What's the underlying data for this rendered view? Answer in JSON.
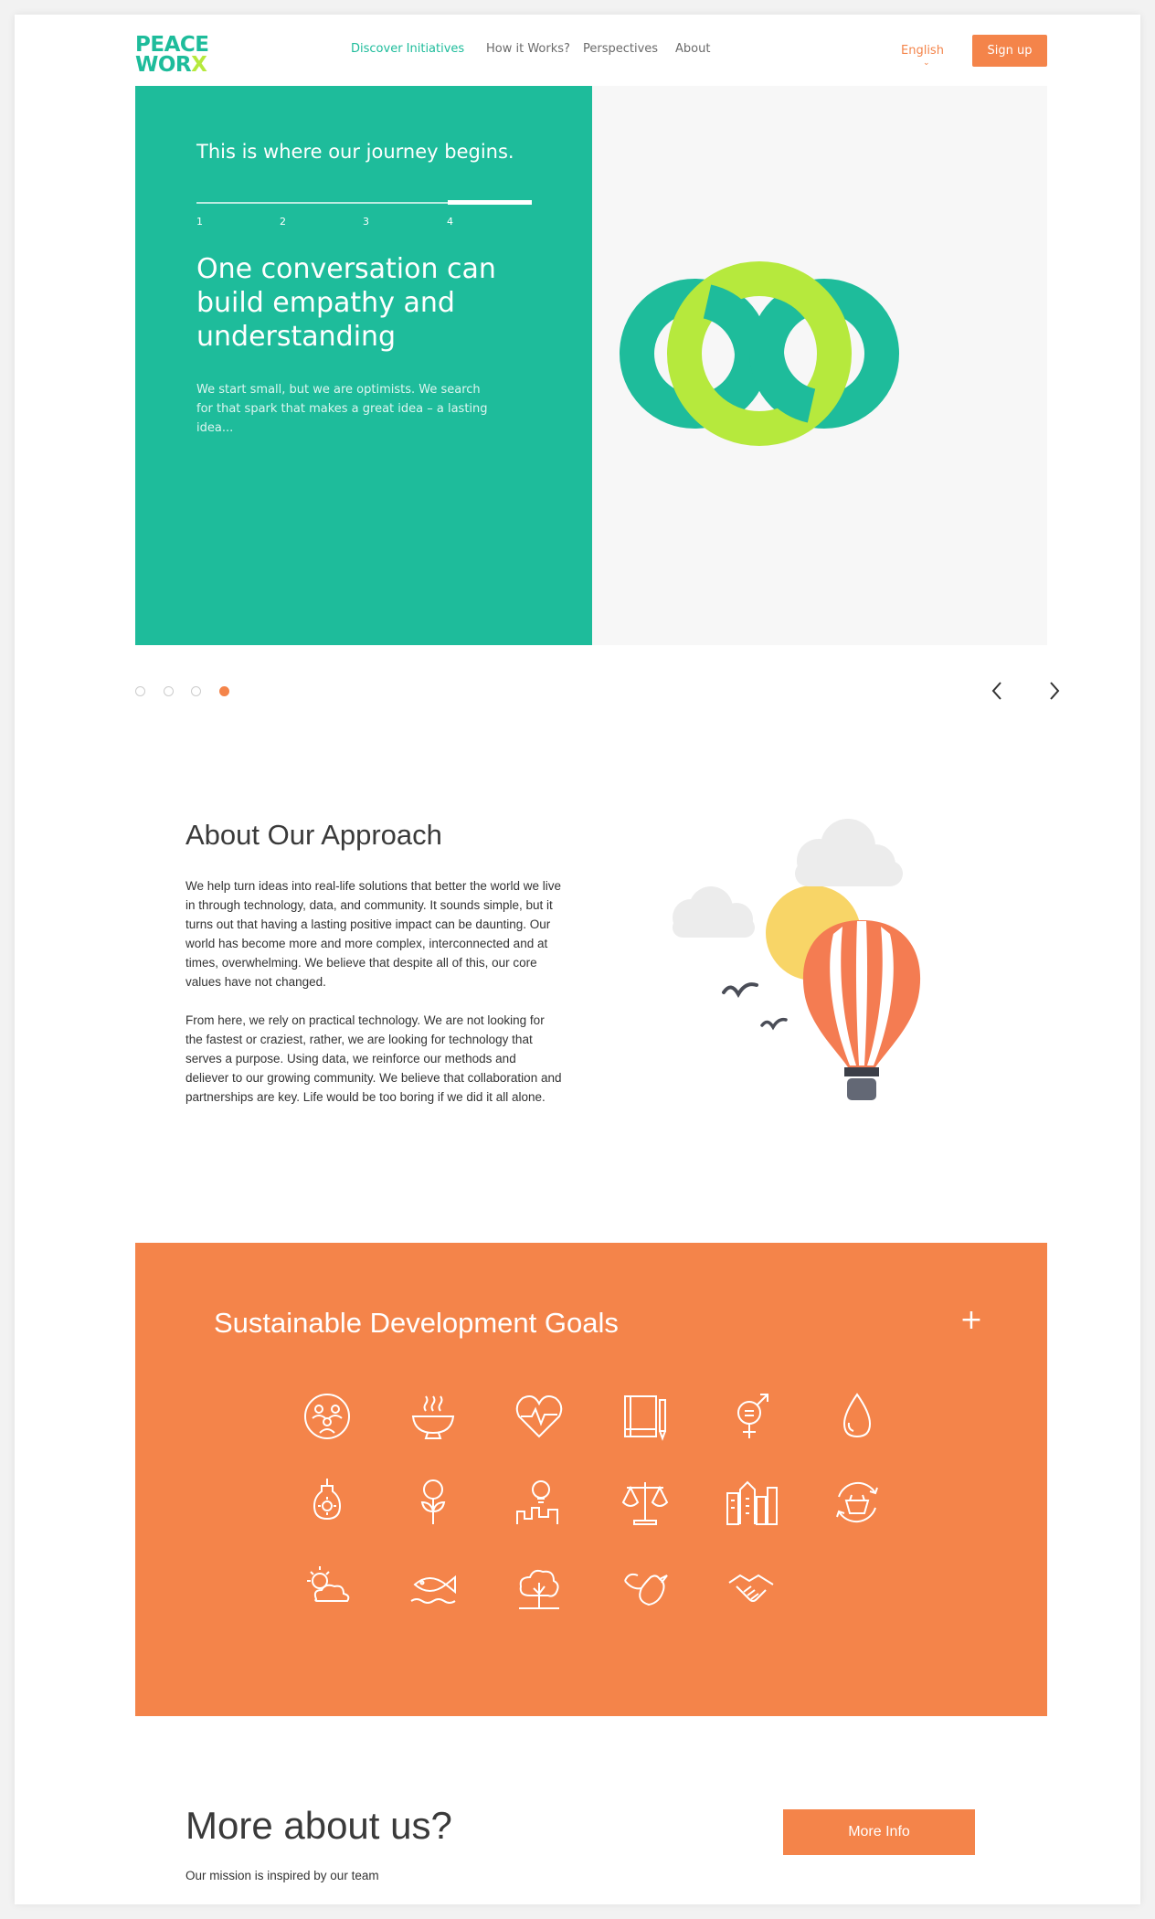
{
  "brand": {
    "logo_line1": "PEACE",
    "logo_line2_a": "WOR",
    "logo_line2_b": "X"
  },
  "nav": {
    "items": [
      {
        "label": "Discover Initiatives",
        "active": true
      },
      {
        "label": "How it Works?",
        "active": false
      },
      {
        "label": "Perspectives",
        "active": false
      },
      {
        "label": "About",
        "active": false
      }
    ],
    "language": "English",
    "signup_label": "Sign up"
  },
  "hero": {
    "kicker": "This is where our journey begins.",
    "steps": [
      "1",
      "2",
      "3",
      "4"
    ],
    "active_step": 4,
    "title": "One conversation can build empathy and understanding",
    "body": "We start small, but we are optimists. We search for that spark that makes a great idea – a lasting idea...",
    "slides": 4,
    "active_slide": 4
  },
  "about": {
    "title": "About Our Approach",
    "paragraphs": [
      "We help turn ideas into real-life solutions that better the world we live in through technology, data, and community. It sounds simple, but it turns out that having a lasting positive impact can be daunting. Our world has become more and more complex, interconnected and at times, overwhelming. We believe that despite all of this, our core values have not changed.",
      "From here, we rely on practical technology. We are not looking for the fastest or craziest, rather, we are looking for technology that serves a purpose. Using data, we reinforce our methods and deliever to our growing community. We believe that collaboration and partnerships are key. Life would be too boring if we did it all alone."
    ]
  },
  "sdg": {
    "title": "Sustainable Development Goals",
    "expand_icon": "+",
    "icons": [
      "no-poverty-icon",
      "zero-hunger-icon",
      "good-health-icon",
      "quality-education-icon",
      "gender-equality-icon",
      "clean-water-icon",
      "clean-energy-icon",
      "economic-growth-icon",
      "innovation-icon",
      "reduced-inequality-icon",
      "sustainable-cities-icon",
      "responsible-consumption-icon",
      "climate-action-icon",
      "life-below-water-icon",
      "life-on-land-icon",
      "peace-justice-icon",
      "partnerships-icon"
    ]
  },
  "more": {
    "title": "More about us?",
    "subtitle": "Our mission is inspired by our team",
    "button_label": "More Info"
  },
  "colors": {
    "teal": "#1ebc9b",
    "lime": "#b6e93d",
    "orange": "#f4844a"
  }
}
